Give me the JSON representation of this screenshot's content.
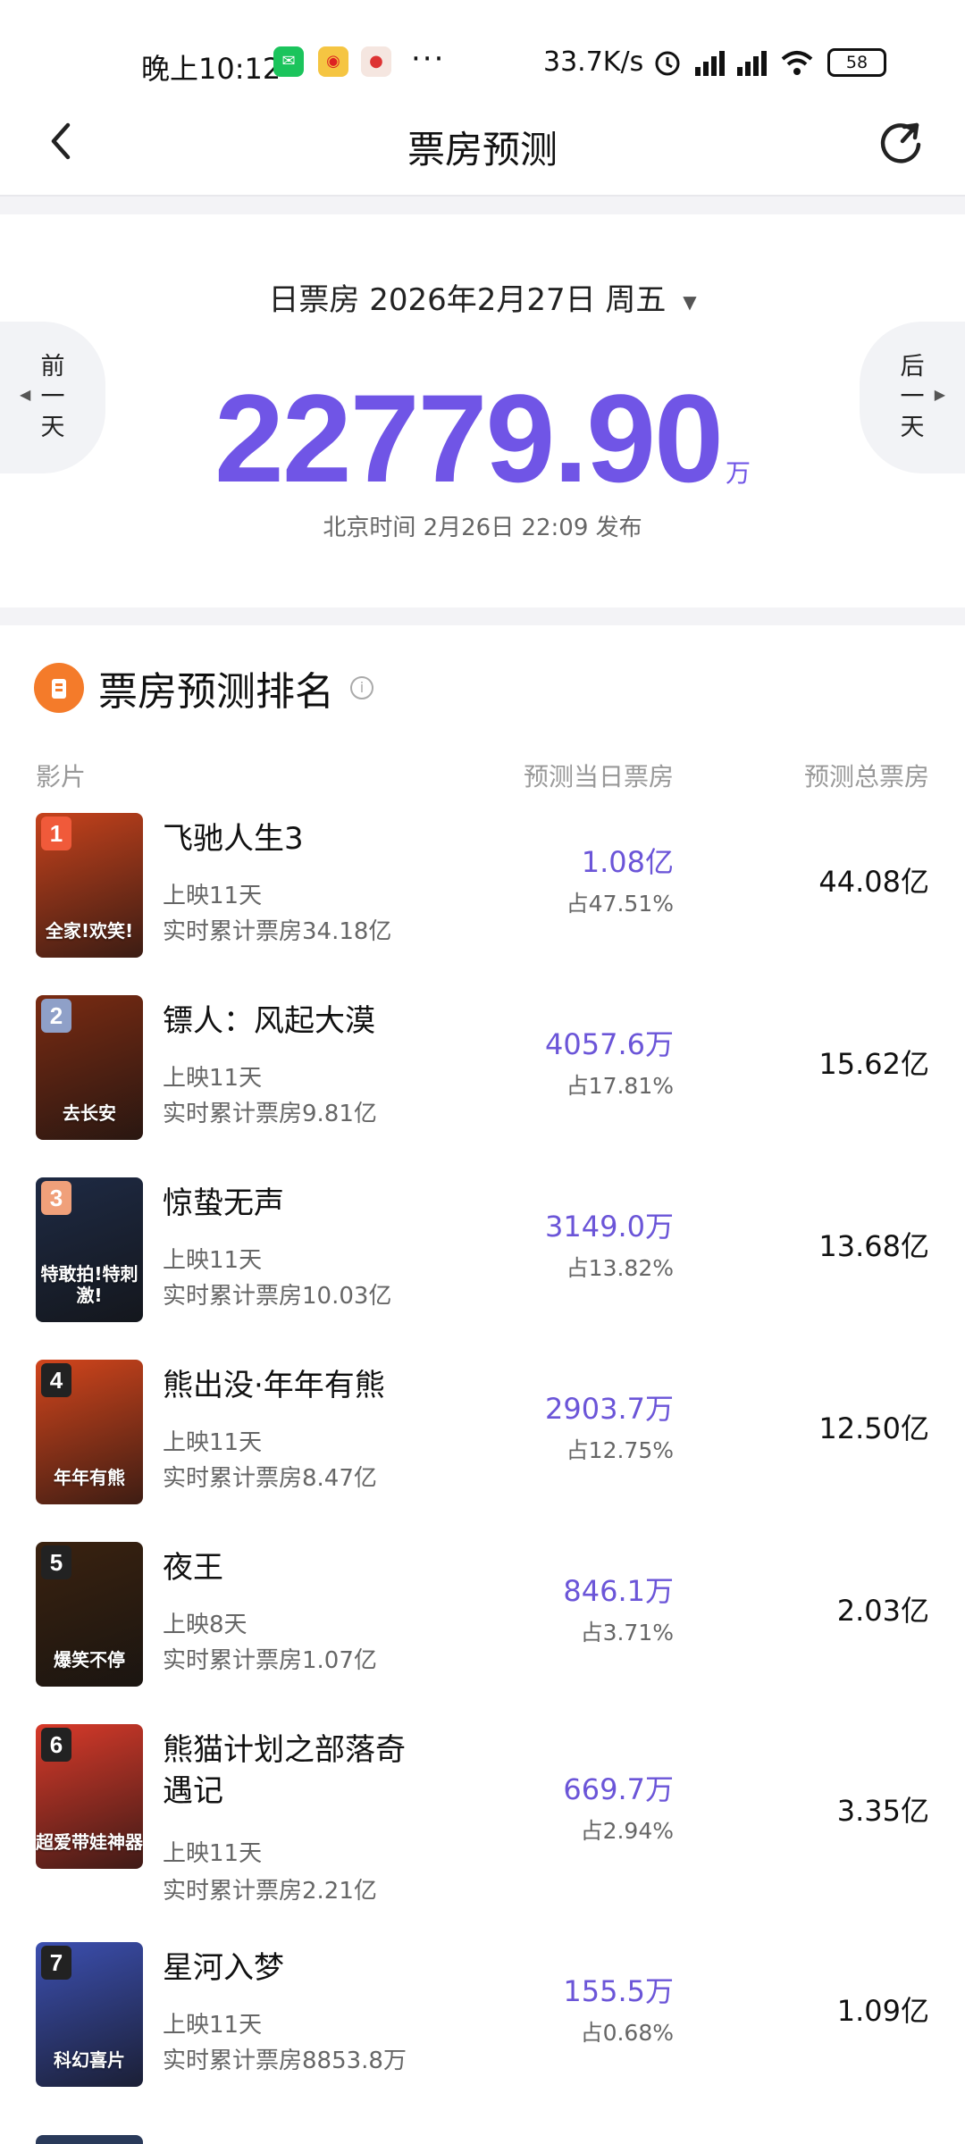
{
  "status": {
    "time": "晚上10:12",
    "speed": "33.7K/s",
    "battery": "58"
  },
  "header": {
    "title": "票房预测"
  },
  "summary": {
    "label": "日票房",
    "date": "2026年2月27日 周五",
    "prev_label": "前一天",
    "next_label": "后一天",
    "total": "22779.90",
    "unit": "万",
    "publish": "北京时间 2月26日 22:09 发布"
  },
  "ranking": {
    "title": "票房预测排名",
    "col_film": "影片",
    "col_day": "预测当日票房",
    "col_total": "预测总票房",
    "movies": [
      {
        "rank": "1",
        "name": "飞驰人生3",
        "days": "上映11天",
        "cumulative": "实时累计票房34.18亿",
        "day_box": "1.08亿",
        "share": "占47.51%",
        "total": "44.08亿",
        "poster_text": "全家!欢笑!",
        "badge_color": "#f05a3a",
        "poster_color": "#c6421c"
      },
      {
        "rank": "2",
        "name": "镖人：风起大漠",
        "days": "上映11天",
        "cumulative": "实时累计票房9.81亿",
        "day_box": "4057.6万",
        "share": "占17.81%",
        "total": "15.62亿",
        "poster_text": "去长安",
        "badge_color": "#8fa0c8",
        "poster_color": "#7a2b12"
      },
      {
        "rank": "3",
        "name": "惊蛰无声",
        "days": "上映11天",
        "cumulative": "实时累计票房10.03亿",
        "day_box": "3149.0万",
        "share": "占13.82%",
        "total": "13.68亿",
        "poster_text": "特敢拍!特刺激!",
        "badge_color": "#f0a07a",
        "poster_color": "#1e2a44"
      },
      {
        "rank": "4",
        "name": "熊出没·年年有熊",
        "days": "上映11天",
        "cumulative": "实时累计票房8.47亿",
        "day_box": "2903.7万",
        "share": "占12.75%",
        "total": "12.50亿",
        "poster_text": "年年有熊",
        "badge_color": "#222222",
        "poster_color": "#d2451c"
      },
      {
        "rank": "5",
        "name": "夜王",
        "days": "上映8天",
        "cumulative": "实时累计票房1.07亿",
        "day_box": "846.1万",
        "share": "占3.71%",
        "total": "2.03亿",
        "poster_text": "爆笑不停",
        "badge_color": "#222222",
        "poster_color": "#3a2210"
      },
      {
        "rank": "6",
        "name": "熊猫计划之部落奇遇记",
        "days": "上映11天",
        "cumulative": "实时累计票房2.21亿",
        "day_box": "669.7万",
        "share": "占2.94%",
        "total": "3.35亿",
        "poster_text": "超爱带娃神器",
        "badge_color": "#222222",
        "poster_color": "#d83a2a"
      },
      {
        "rank": "7",
        "name": "星河入梦",
        "days": "上映11天",
        "cumulative": "实时累计票房8853.8万",
        "day_box": "155.5万",
        "share": "占0.68%",
        "total": "1.09亿",
        "poster_text": "科幻喜片",
        "badge_color": "#222222",
        "poster_color": "#3c4fb0"
      }
    ]
  }
}
